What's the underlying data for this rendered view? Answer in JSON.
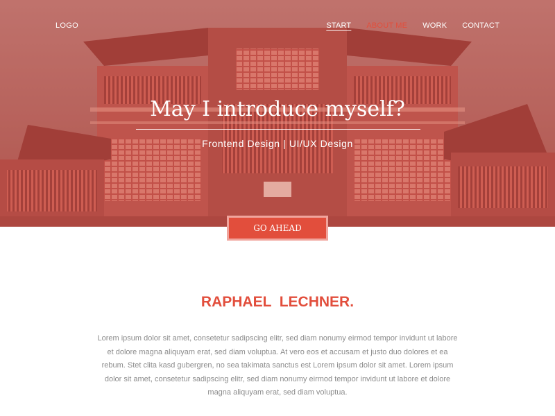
{
  "nav": {
    "logo": "LOGO",
    "links": [
      {
        "label": "START"
      },
      {
        "label": "ABOUT ME"
      },
      {
        "label": "WORK"
      },
      {
        "label": "CONTACT"
      }
    ]
  },
  "hero": {
    "title": "May I introduce myself?",
    "subtitle": "Frontend Design | UI/UX Design",
    "cta_label": "GO AHEAD"
  },
  "about": {
    "name": "RAPHAEL  LECHNER.",
    "bio": "Lorem ipsum dolor sit amet, consetetur sadipscing elitr, sed diam nonumy eirmod tempor invidunt ut labore et dolore magna aliquyam erat, sed diam voluptua. At vero eos et accusam et justo duo dolores et ea rebum. Stet clita kasd gubergren, no sea takimata sanctus est Lorem ipsum dolor sit amet. Lorem ipsum dolor sit amet, consetetur sadipscing elitr, sed diam nonumy eirmod tempor invidunt ut labore et dolore magna aliquyam erat, sed diam voluptua."
  },
  "colors": {
    "accent": "#e24e3c",
    "accent_border": "#f0a49c",
    "body_text": "#8c8c8c",
    "hero_tint": "#c0706a"
  },
  "icons": {
    "hero_background": "temple-photo"
  }
}
